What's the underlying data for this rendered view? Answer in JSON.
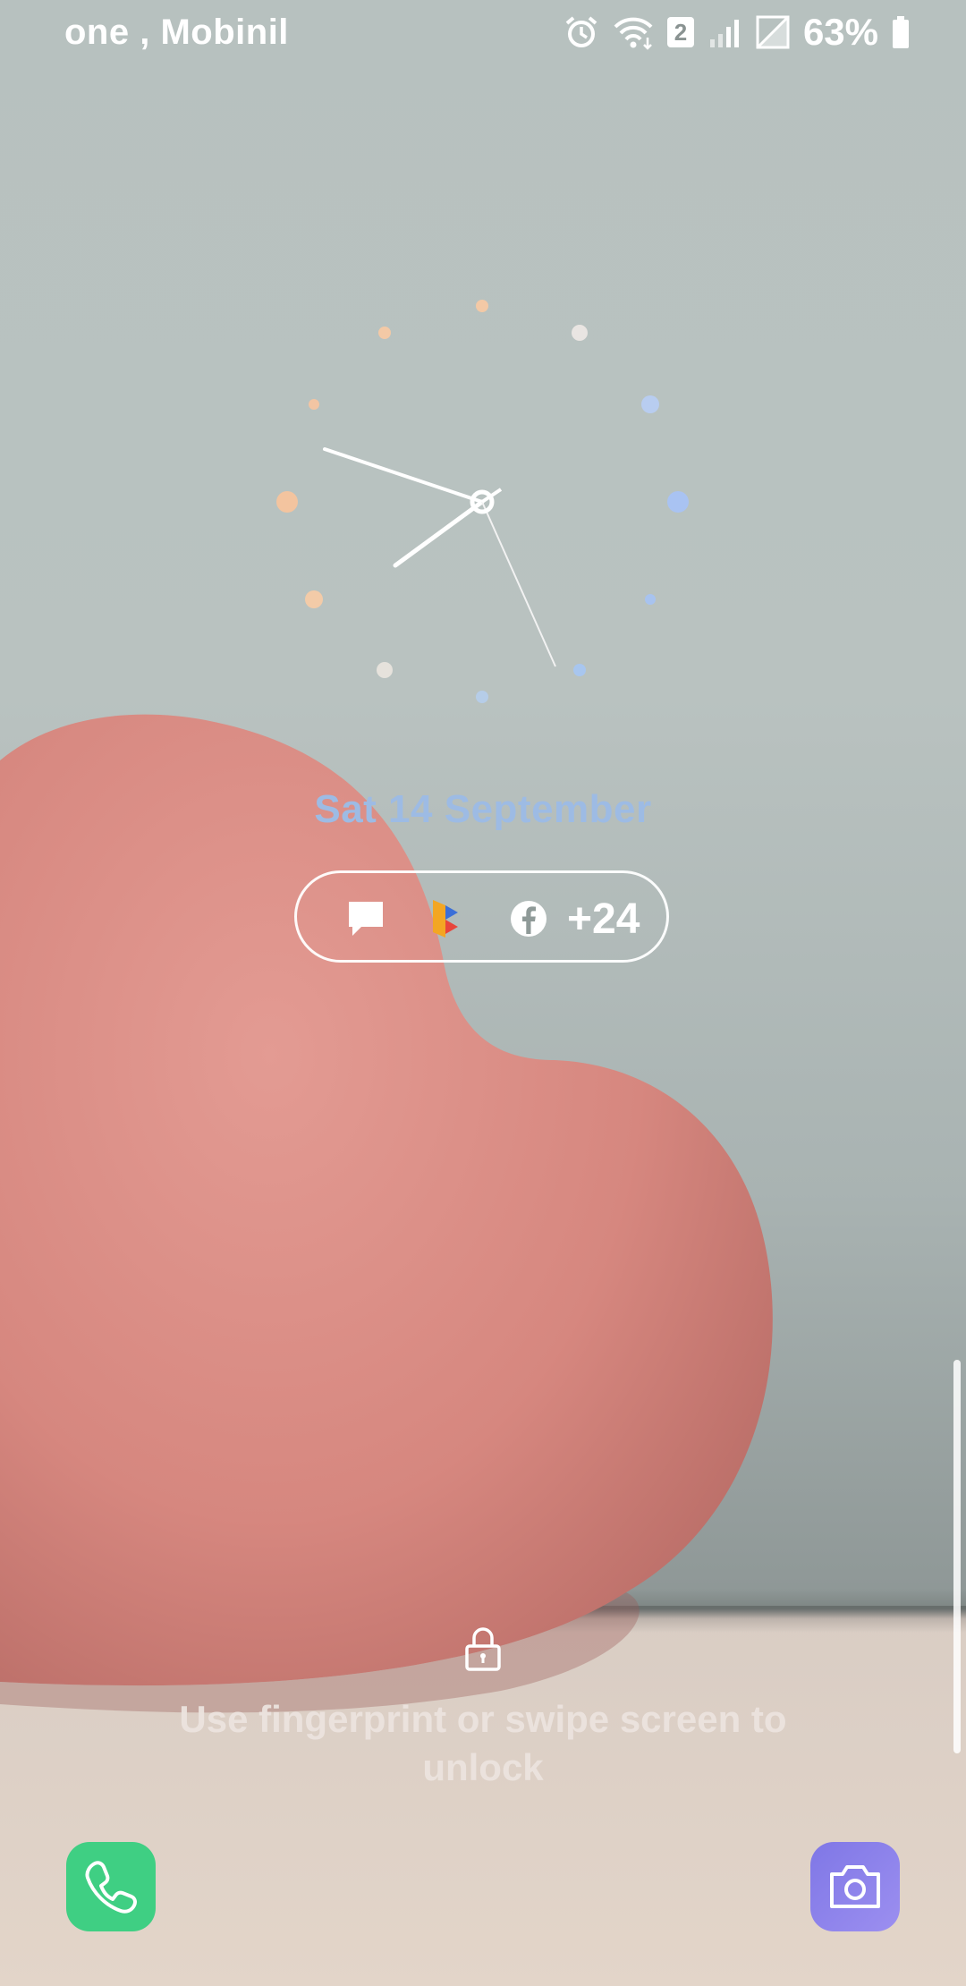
{
  "status_bar": {
    "carrier": "one , Mobinil",
    "sim_badge": "2",
    "battery": "63%",
    "icons": [
      "alarm-icon",
      "wifi-icon",
      "signal-icon",
      "no-sim-signal-icon",
      "battery-icon"
    ]
  },
  "lockscreen": {
    "date": "Sat 14 September",
    "notifications": {
      "icons": [
        "message-icon",
        "flickr-app-icon",
        "facebook-icon"
      ],
      "more_count": "+24"
    },
    "unlock_hint": "Use fingerprint or swipe screen to unlock"
  },
  "shortcuts": {
    "left": "phone-icon",
    "right": "camera-icon"
  },
  "colors": {
    "date": "#9dbbe4",
    "phone_button": "#3fcf83",
    "camera_button": "#8f86ec",
    "heart": "#d98882"
  }
}
